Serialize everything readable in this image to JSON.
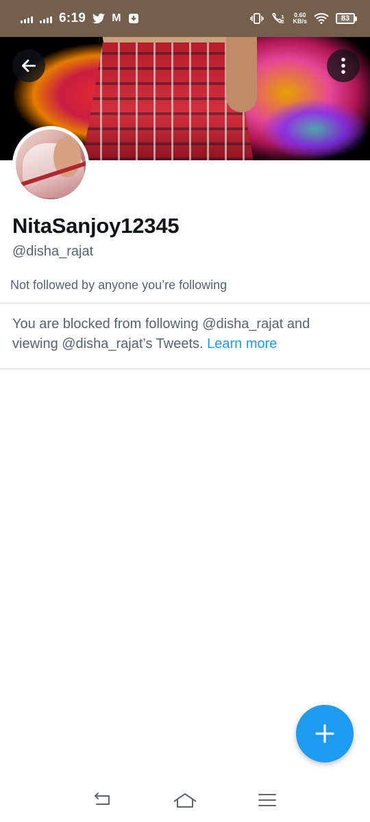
{
  "status_bar": {
    "time": "6:19",
    "twitter_icon": "twitter-bird-icon",
    "m_icon": "M",
    "net_speed": "0.60",
    "net_unit": "KB/s",
    "battery": "83"
  },
  "profile": {
    "display_name": "NitaSanjoy12345",
    "handle": "@disha_rajat",
    "followed_note": "Not followed by anyone you’re following",
    "blocked_message": "You are blocked from following @disha_rajat and viewing @disha_rajat’s Tweets.",
    "learn_more": "Learn more"
  },
  "icons": {
    "back": "back-arrow-icon",
    "more": "more-vertical-icon",
    "compose": "plus-icon",
    "nav_back": "nav-back-icon",
    "nav_home": "nav-home-icon",
    "nav_menu": "nav-menu-icon"
  },
  "colors": {
    "status_bar": "#735f4c",
    "accent": "#1d9bf0",
    "text_primary": "#0f1419",
    "text_secondary": "#536471"
  }
}
